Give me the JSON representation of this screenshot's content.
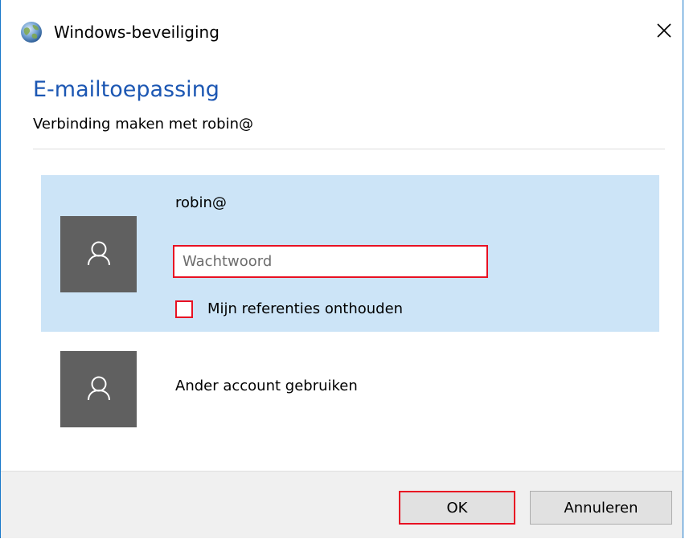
{
  "window": {
    "title": "Windows-beveiliging",
    "icon": "windows-security-globe-icon",
    "close_icon": "close-icon"
  },
  "header": {
    "app_name": "E-mailtoepassing",
    "subtitle": "Verbinding maken met robin@"
  },
  "selected_account": {
    "username": "robin@",
    "avatar_icon": "user-icon",
    "password": {
      "value": "",
      "placeholder": "Wachtwoord"
    },
    "remember": {
      "label": "Mijn referenties onthouden",
      "checked": false
    }
  },
  "other_account": {
    "label": "Ander account gebruiken",
    "avatar_icon": "user-icon"
  },
  "buttons": {
    "ok": "OK",
    "cancel": "Annuleren"
  },
  "colors": {
    "accent": "#1c57b3",
    "selection": "#cce4f7",
    "highlight": "#e81123",
    "avatar": "#606060",
    "footer": "#f0f0f0"
  }
}
